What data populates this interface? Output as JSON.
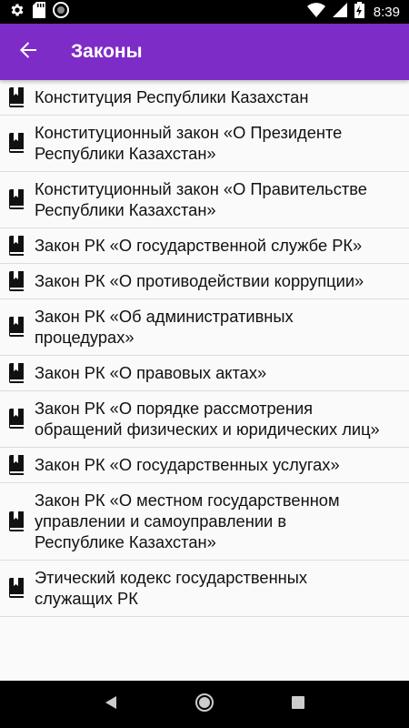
{
  "status_bar": {
    "time": "8:39",
    "left_icons": [
      "gear-icon",
      "sd-card-icon",
      "sync-circle-icon"
    ],
    "right_icons": [
      "wifi-icon",
      "signal-icon",
      "battery-charging-icon"
    ]
  },
  "app_bar": {
    "title": "Законы",
    "back_icon": "arrow-back-icon",
    "color": "#7e2cc7"
  },
  "laws": [
    {
      "label": "Конституция Республики Казахстан"
    },
    {
      "label": "Конституционный закон «О Президенте\nРеспублики Казахстан»"
    },
    {
      "label": "Конституционный закон «О Правительстве\nРеспублики Казахстан»"
    },
    {
      "label": "Закон РК «О государственной службе РК»"
    },
    {
      "label": "Закон РК «О противодействии коррупции»"
    },
    {
      "label": "Закон РК «Об административных\nпроцедурах»"
    },
    {
      "label": "Закон РК «О правовых актах»"
    },
    {
      "label": "Закон РК «О порядке рассмотрения\nобращений физических и юридических лиц»"
    },
    {
      "label": "Закон РК «О государственных услугах»"
    },
    {
      "label": "Закон РК «О местном государственном\nуправлении и самоуправлении в\nРеспублике Казахстан»"
    },
    {
      "label": "Этический кодекс государственных\nслужащих РК"
    }
  ],
  "nav_bar": {
    "icons": [
      "back-triangle-icon",
      "home-circle-icon",
      "recents-square-icon"
    ]
  }
}
